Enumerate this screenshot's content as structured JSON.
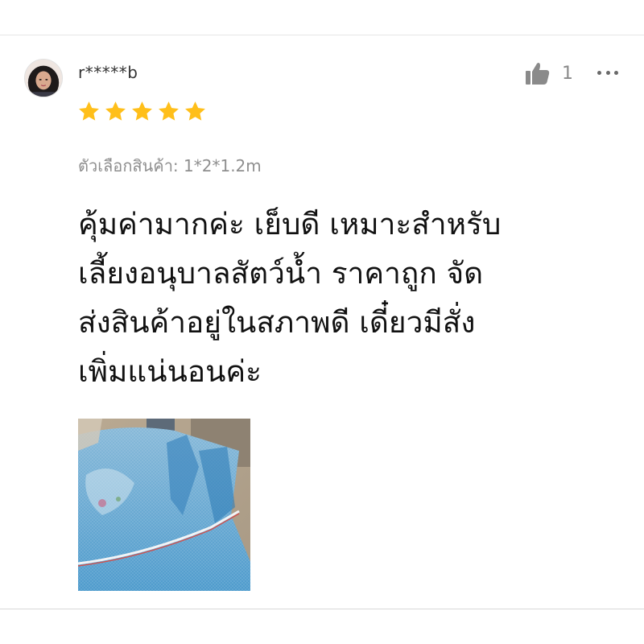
{
  "review": {
    "username": "r*****b",
    "rating": 5,
    "rating_max": 5,
    "like_count": "1",
    "variation_label": "ตัวเลือกสินค้า: 1*2*1.2m",
    "comment_lines": [
      "คุ้มค่ามากค่ะ เย็บดี เหมาะสำหรับ",
      "เลี้ยงอนุบาลสัตว์น้ำ ราคาถูก จัด",
      "ส่งสินค้าอยู่ในสภาพดี เดี๋ยวมีสั่ง",
      "เพิ่มแน่นอนค่ะ"
    ]
  },
  "colors": {
    "star": "#ffbf1a",
    "text_primary": "#111111",
    "text_secondary": "#8f8f8f",
    "icon_grey": "#8a8a8a"
  },
  "icons": {
    "rating": "star-icon",
    "like": "thumbs-up-icon",
    "menu": "more-horizontal-icon"
  }
}
